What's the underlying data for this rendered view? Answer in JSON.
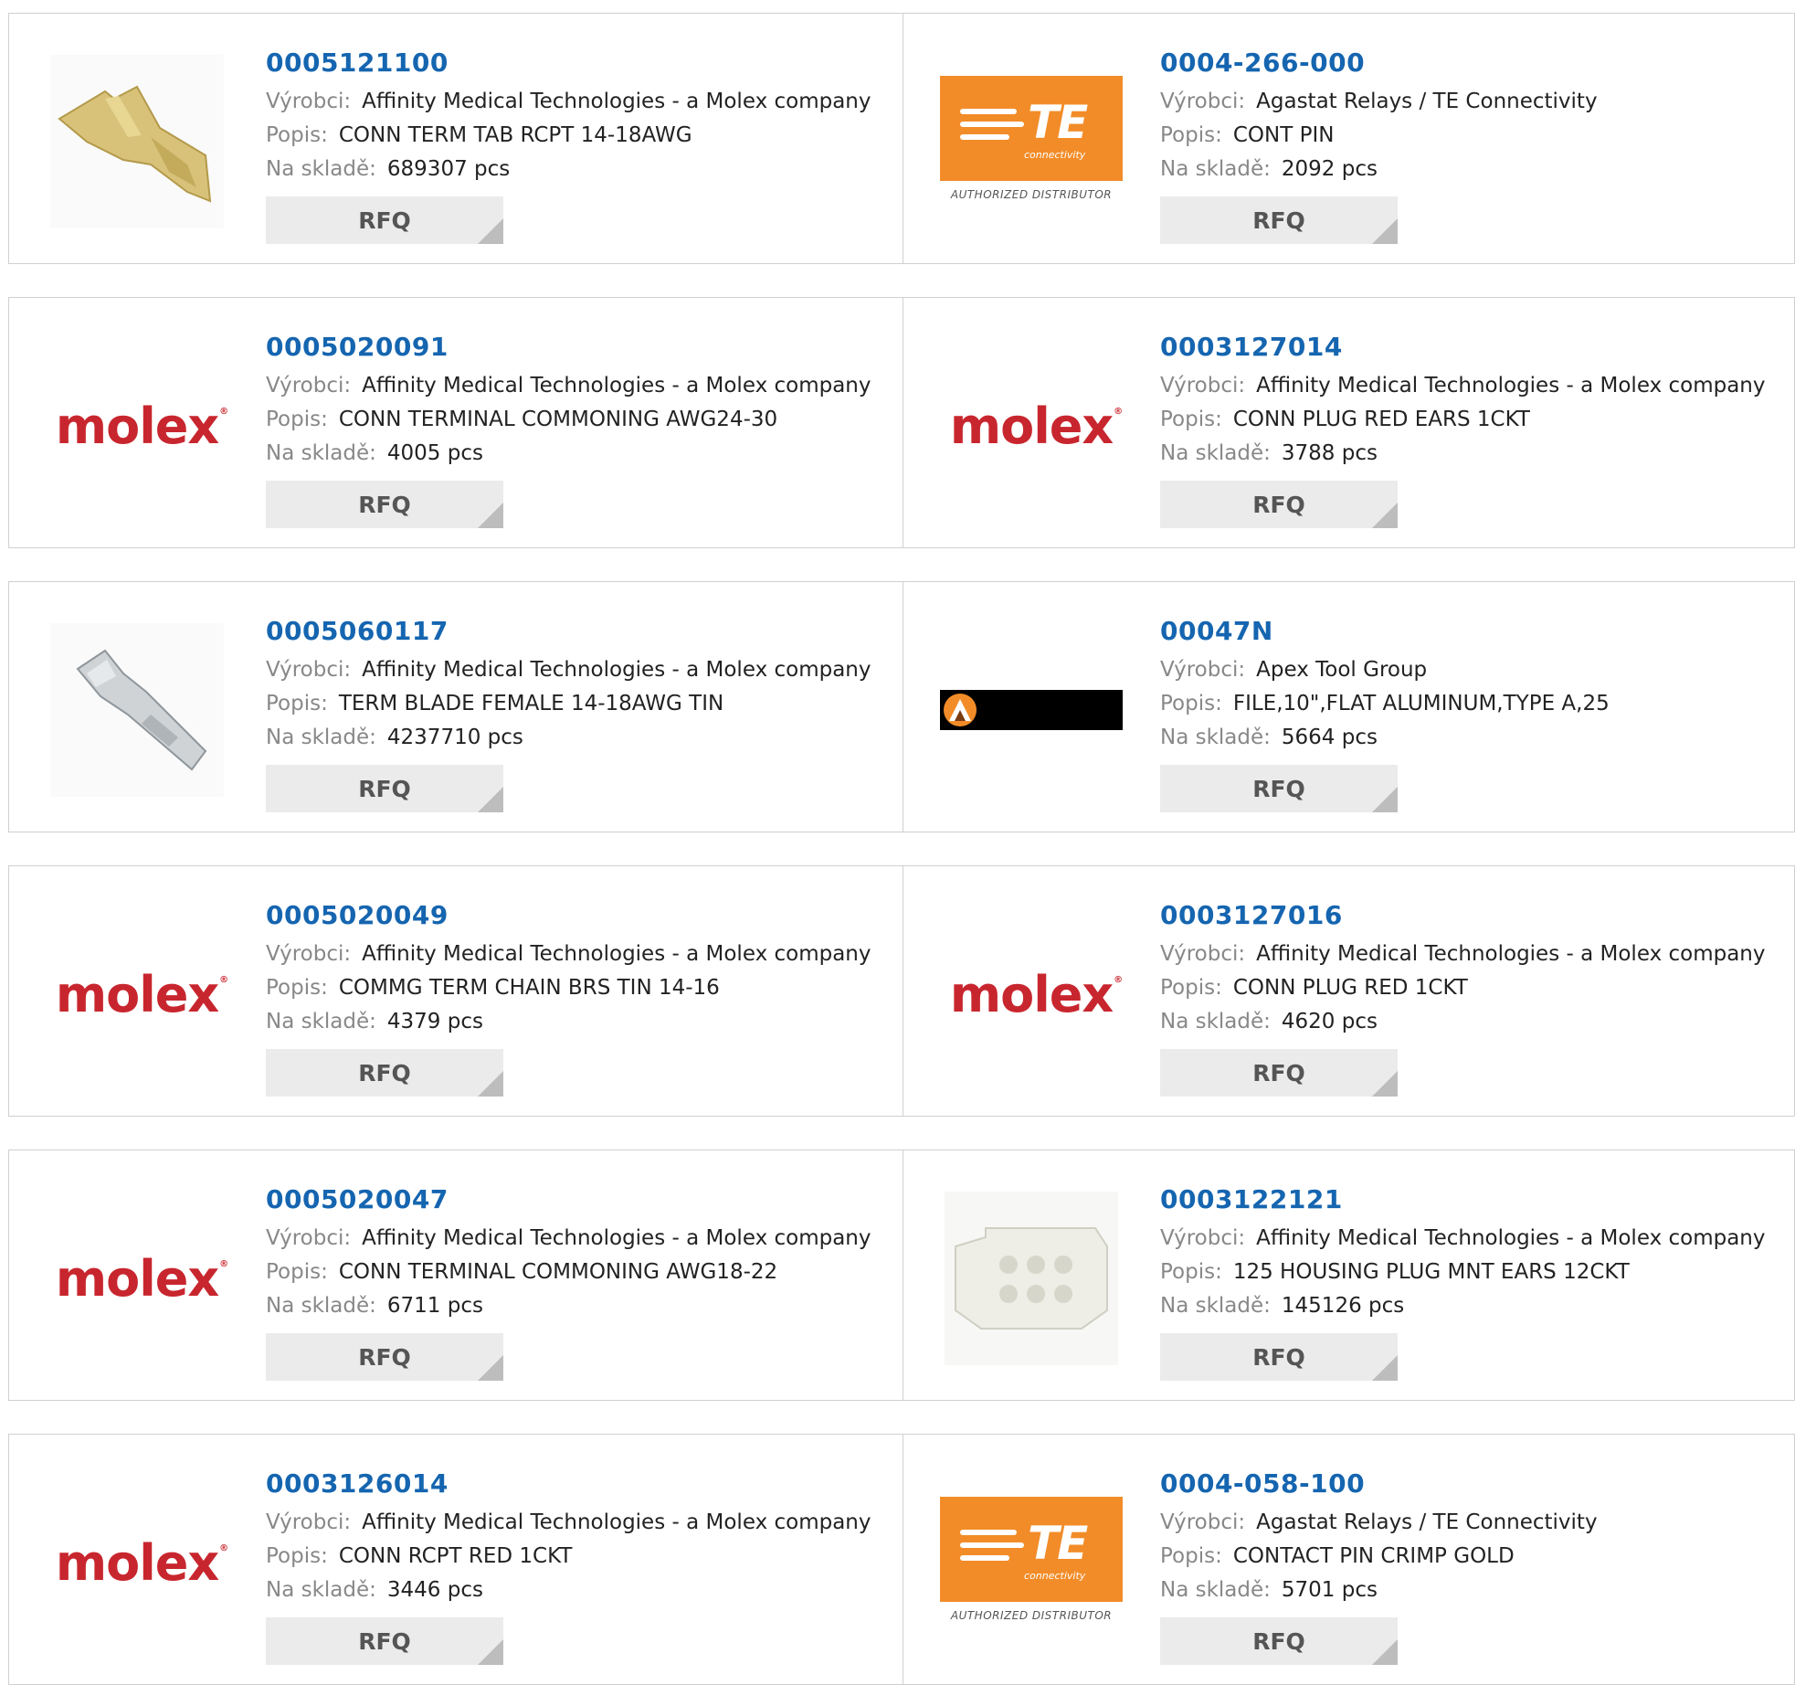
{
  "labels": {
    "manufacturer": "Výrobci:",
    "description": "Popis:",
    "stock": "Na skladě:",
    "rfq": "RFQ"
  },
  "logos": {
    "molex_text": "molex",
    "molex_reg": "®",
    "te_letters": "TE",
    "te_sub": "connectivity",
    "te_authorized": "AUTHORIZED DISTRIBUTOR"
  },
  "colors": {
    "part_link": "#1565b0",
    "molex_red": "#c8262e",
    "te_orange": "#f28c28"
  },
  "products": [
    {
      "part": "0005121100",
      "manufacturer": "Affinity Medical Technologies - a Molex company",
      "description": "CONN TERM TAB RCPT 14-18AWG",
      "stock": "689307 pcs",
      "image": "tab-terminal-photo"
    },
    {
      "part": "0004-266-000",
      "manufacturer": "Agastat Relays / TE Connectivity",
      "description": "CONT PIN",
      "stock": "2092 pcs",
      "image": "te-logo"
    },
    {
      "part": "0005020091",
      "manufacturer": "Affinity Medical Technologies - a Molex company",
      "description": "CONN TERMINAL COMMONING AWG24-30",
      "stock": "4005 pcs",
      "image": "molex-logo"
    },
    {
      "part": "0003127014",
      "manufacturer": "Affinity Medical Technologies - a Molex company",
      "description": "CONN PLUG RED EARS 1CKT",
      "stock": "3788 pcs",
      "image": "molex-logo"
    },
    {
      "part": "0005060117",
      "manufacturer": "Affinity Medical Technologies - a Molex company",
      "description": "TERM BLADE FEMALE 14-18AWG TIN",
      "stock": "4237710 pcs",
      "image": "blade-terminal-photo"
    },
    {
      "part": "00047N",
      "manufacturer": "Apex Tool Group",
      "description": "FILE,10\",FLAT ALUMINUM,TYPE A,25",
      "stock": "5664 pcs",
      "image": "apex-logo"
    },
    {
      "part": "0005020049",
      "manufacturer": "Affinity Medical Technologies - a Molex company",
      "description": "COMMG TERM CHAIN BRS TIN 14-16",
      "stock": "4379 pcs",
      "image": "molex-logo"
    },
    {
      "part": "0003127016",
      "manufacturer": "Affinity Medical Technologies - a Molex company",
      "description": "CONN PLUG RED 1CKT",
      "stock": "4620 pcs",
      "image": "molex-logo"
    },
    {
      "part": "0005020047",
      "manufacturer": "Affinity Medical Technologies - a Molex company",
      "description": "CONN TERMINAL COMMONING AWG18-22",
      "stock": "6711 pcs",
      "image": "molex-logo"
    },
    {
      "part": "0003122121",
      "manufacturer": "Affinity Medical Technologies - a Molex company",
      "description": "125 HOUSING PLUG MNT EARS 12CKT",
      "stock": "145126 pcs",
      "image": "housing-plug-photo"
    },
    {
      "part": "0003126014",
      "manufacturer": "Affinity Medical Technologies - a Molex company",
      "description": "CONN RCPT RED 1CKT",
      "stock": "3446 pcs",
      "image": "molex-logo"
    },
    {
      "part": "0004-058-100",
      "manufacturer": "Agastat Relays / TE Connectivity",
      "description": "CONTACT PIN CRIMP GOLD",
      "stock": "5701 pcs",
      "image": "te-logo"
    }
  ]
}
